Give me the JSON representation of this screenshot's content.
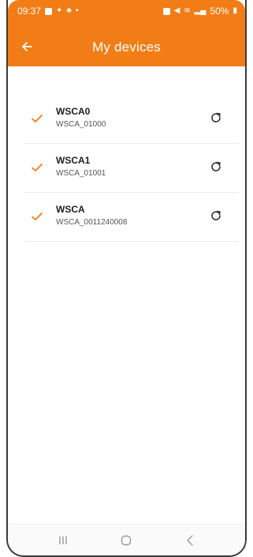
{
  "status_bar": {
    "time": "09:37",
    "battery": "50%"
  },
  "header": {
    "title": "My devices",
    "back_icon": "arrow-left-icon"
  },
  "devices": [
    {
      "name": "WSCA0",
      "id": "WSCA_01000",
      "status_icon": "check-icon",
      "action_icon": "refresh-icon"
    },
    {
      "name": "WSCA1",
      "id": "WSCA_01001",
      "status_icon": "check-icon",
      "action_icon": "refresh-icon"
    },
    {
      "name": "WSCA",
      "id": "WSCA_0011240008",
      "status_icon": "check-icon",
      "action_icon": "refresh-icon"
    }
  ],
  "nav": {
    "icons": [
      "recents-icon",
      "home-icon",
      "back-icon"
    ]
  },
  "colors": {
    "accent": "#f27d16",
    "check": "#f27d16",
    "text_primary": "#1e1e1e",
    "text_secondary": "#555555"
  }
}
